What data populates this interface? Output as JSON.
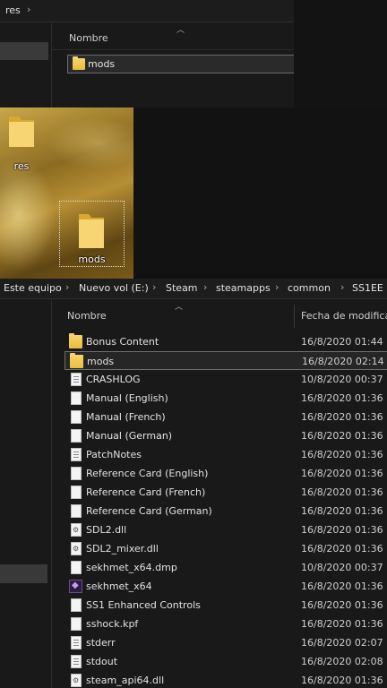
{
  "top_window": {
    "breadcrumb": [
      "res"
    ],
    "column_name": "Nombre",
    "rows": [
      {
        "name": "mods",
        "icon": "folder-icon"
      }
    ]
  },
  "desktop": {
    "icons": [
      {
        "label": "res",
        "icon": "folder-icon"
      },
      {
        "label": "mods",
        "icon": "folder-icon",
        "selected": true
      }
    ]
  },
  "bottom_window": {
    "breadcrumb": [
      "Este equipo",
      "Nuevo vol (E:)",
      "Steam",
      "steamapps",
      "common",
      "SS1EE"
    ],
    "columns": {
      "name": "Nombre",
      "date": "Fecha de modifica"
    },
    "rows": [
      {
        "name": "Bonus Content",
        "date": "16/8/2020 01:44",
        "icon": "folder-icon"
      },
      {
        "name": "mods",
        "date": "16/8/2020 02:14",
        "icon": "folder-icon",
        "selected": true
      },
      {
        "name": "CRASHLOG",
        "date": "10/8/2020 00:37",
        "icon": "text-file-icon"
      },
      {
        "name": "Manual (English)",
        "date": "16/8/2020 01:36",
        "icon": "file-icon"
      },
      {
        "name": "Manual (French)",
        "date": "16/8/2020 01:36",
        "icon": "file-icon"
      },
      {
        "name": "Manual (German)",
        "date": "16/8/2020 01:36",
        "icon": "file-icon"
      },
      {
        "name": "PatchNotes",
        "date": "16/8/2020 01:36",
        "icon": "text-file-icon"
      },
      {
        "name": "Reference Card (English)",
        "date": "16/8/2020 01:36",
        "icon": "file-icon"
      },
      {
        "name": "Reference Card (French)",
        "date": "16/8/2020 01:36",
        "icon": "file-icon"
      },
      {
        "name": "Reference Card (German)",
        "date": "16/8/2020 01:36",
        "icon": "file-icon"
      },
      {
        "name": "SDL2.dll",
        "date": "16/8/2020 01:36",
        "icon": "dll-icon"
      },
      {
        "name": "SDL2_mixer.dll",
        "date": "16/8/2020 01:36",
        "icon": "dll-icon"
      },
      {
        "name": "sekhmet_x64.dmp",
        "date": "10/8/2020 00:37",
        "icon": "file-icon"
      },
      {
        "name": "sekhmet_x64",
        "date": "16/8/2020 01:36",
        "icon": "exe-icon"
      },
      {
        "name": "SS1 Enhanced Controls",
        "date": "16/8/2020 01:36",
        "icon": "file-icon"
      },
      {
        "name": "sshock.kpf",
        "date": "16/8/2020 01:36",
        "icon": "file-icon"
      },
      {
        "name": "stderr",
        "date": "16/8/2020 02:07",
        "icon": "text-file-icon"
      },
      {
        "name": "stdout",
        "date": "16/8/2020 02:08",
        "icon": "text-file-icon"
      },
      {
        "name": "steam_api64.dll",
        "date": "16/8/2020 01:36",
        "icon": "dll-icon"
      }
    ]
  }
}
